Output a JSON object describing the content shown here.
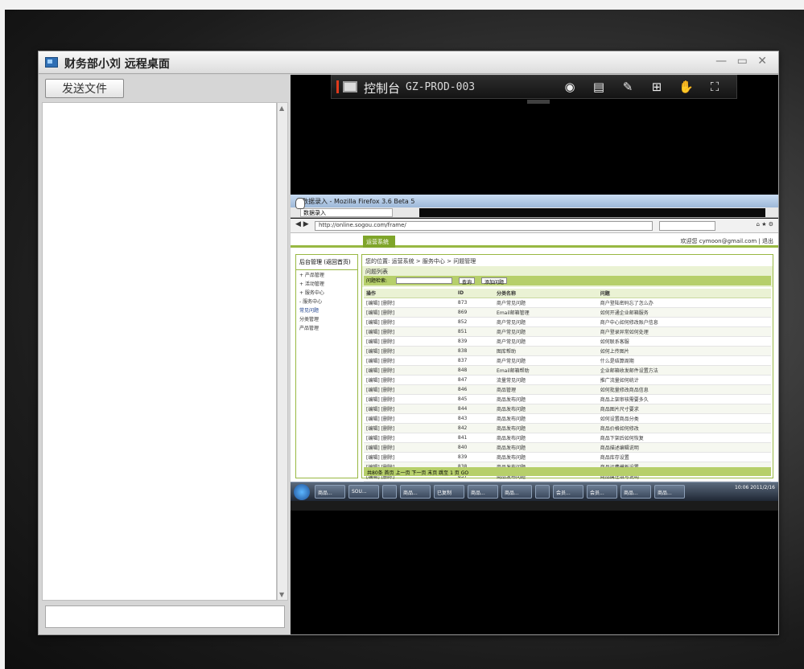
{
  "window": {
    "title": "财务部小刘 远程桌面",
    "controls": "— ▭ ✕"
  },
  "left_panel": {
    "send_file_label": "发送文件",
    "chat_input_value": ""
  },
  "control_bar": {
    "label": "控制台",
    "host": "GZ-PROD-003",
    "icons": [
      "eye-icon",
      "screen-icon",
      "puzzle-icon",
      "fit-screen-icon",
      "hand-icon",
      "fullscreen-icon"
    ]
  },
  "remote": {
    "browser_title": "数据录入 - Mozilla Firefox 3.6 Beta 5",
    "tab_label": "数据录入",
    "url": "http://online.sogou.com/frame/",
    "search_placeholder": "Any",
    "site_tab": "运营系统",
    "user_info": "欢迎您 cymoon@gmail.com | 退出",
    "sidebar_title": "后台管理 (返回首页)",
    "sidebar_items": [
      {
        "label": "+ 产品管理",
        "active": false
      },
      {
        "label": "+ 活动管理",
        "active": false
      },
      {
        "label": "+ 服务中心",
        "active": false
      },
      {
        "label": "- 服务中心",
        "active": false
      },
      {
        "label": "常见问题",
        "active": true
      },
      {
        "label": "分类管理",
        "active": false
      },
      {
        "label": "产品管理",
        "active": false
      }
    ],
    "breadcrumb": "您的位置: 运营系统 > 服务中心 > 问题管理",
    "filter_title": "问题列表",
    "filter_label": "问题检索:",
    "filter_buttons": [
      "查询",
      "添加问题"
    ],
    "columns": [
      "操作",
      "ID",
      "分类名称",
      "问题"
    ],
    "rows": [
      {
        "op": "[编辑] [删除]",
        "id": "873",
        "cat": "商户常见问题",
        "q": "商户登陆密码忘了怎么办",
        "hl": false
      },
      {
        "op": "[编辑] [删除]",
        "id": "869",
        "cat": "Email邮箱管理",
        "q": "如何开通企业邮箱服务",
        "hl": false
      },
      {
        "op": "[编辑] [删除]",
        "id": "852",
        "cat": "商户常见问题",
        "q": "商户中心如何修改账户信息",
        "hl": false
      },
      {
        "op": "[编辑] [删除]",
        "id": "851",
        "cat": "商户常见问题",
        "q": "商户登录异常如何处理",
        "hl": false
      },
      {
        "op": "[编辑] [删除]",
        "id": "839",
        "cat": "商户常见问题",
        "q": "如何联系客服",
        "hl": false
      },
      {
        "op": "[编辑] [删除]",
        "id": "838",
        "cat": "图库帮助",
        "q": "如何上传图片",
        "hl": false
      },
      {
        "op": "[编辑] [删除]",
        "id": "837",
        "cat": "商户常见问题",
        "q": "什么是结算周期",
        "hl": true
      },
      {
        "op": "[编辑] [删除]",
        "id": "848",
        "cat": "Email邮箱帮助",
        "q": "企业邮箱收发邮件设置方法",
        "hl": false
      },
      {
        "op": "[编辑] [删除]",
        "id": "847",
        "cat": "流量常见问题",
        "q": "推广流量如何统计",
        "hl": false
      },
      {
        "op": "[编辑] [删除]",
        "id": "846",
        "cat": "商品管理",
        "q": "如何批量修改商品信息",
        "hl": false
      },
      {
        "op": "[编辑] [删除]",
        "id": "845",
        "cat": "商品发布问题",
        "q": "商品上架审核需要多久",
        "hl": false
      },
      {
        "op": "[编辑] [删除]",
        "id": "844",
        "cat": "商品发布问题",
        "q": "商品图片尺寸要求",
        "hl": false
      },
      {
        "op": "[编辑] [删除]",
        "id": "843",
        "cat": "商品发布问题",
        "q": "如何设置商品分类",
        "hl": false
      },
      {
        "op": "[编辑] [删除]",
        "id": "842",
        "cat": "商品发布问题",
        "q": "商品价格如何修改",
        "hl": false
      },
      {
        "op": "[编辑] [删除]",
        "id": "841",
        "cat": "商品发布问题",
        "q": "商品下架后如何恢复",
        "hl": false
      },
      {
        "op": "[编辑] [删除]",
        "id": "840",
        "cat": "商品发布问题",
        "q": "商品描述编辑说明",
        "hl": false
      },
      {
        "op": "[编辑] [删除]",
        "id": "839",
        "cat": "商品发布问题",
        "q": "商品库存设置",
        "hl": false
      },
      {
        "op": "[编辑] [删除]",
        "id": "838",
        "cat": "商品发布问题",
        "q": "商品运费模板设置",
        "hl": false
      },
      {
        "op": "[编辑] [删除]",
        "id": "837",
        "cat": "商品发布问题",
        "q": "商品属性填写说明",
        "hl": false
      },
      {
        "op": "[编辑] [删除]",
        "id": "836",
        "cat": "图库帮助",
        "q": "如何删除图片",
        "hl": false
      }
    ],
    "pager": "共80条 首页 上一页 下一页 末页 跳至 1 页 GO",
    "taskbar_items": [
      "商品...",
      "SOU...",
      "",
      "商品...",
      "已复制",
      "商品...",
      "商品...",
      "",
      "会员...",
      "会员...",
      "商品...",
      "商品..."
    ],
    "clock": "10:06 2011/2/16"
  }
}
